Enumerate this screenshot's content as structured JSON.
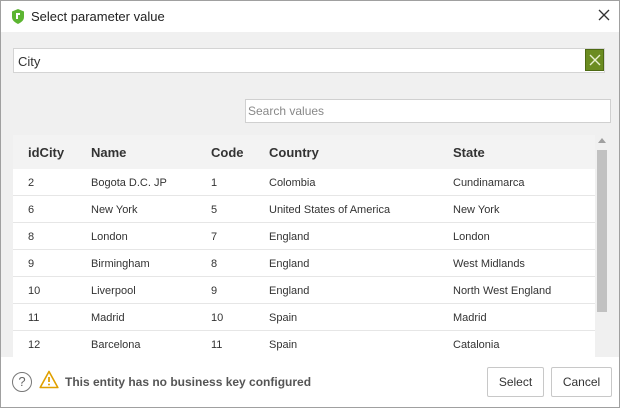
{
  "window": {
    "title": "Select parameter value",
    "icon": "app-shield-icon",
    "close_icon": "close-icon"
  },
  "parameter": {
    "value": "City",
    "clear_icon": "clear-x-icon",
    "clear_color": "#6b8c21"
  },
  "search": {
    "placeholder": "Search values",
    "value": ""
  },
  "table": {
    "columns": [
      "idCity",
      "Name",
      "Code",
      "Country",
      "State"
    ],
    "rows": [
      [
        "2",
        "Bogota D.C. JP",
        "1",
        "Colombia",
        "Cundinamarca"
      ],
      [
        "6",
        "New York",
        "5",
        "United States of America",
        "New York"
      ],
      [
        "8",
        "London",
        "7",
        "England",
        "London"
      ],
      [
        "9",
        "Birmingham",
        "8",
        "England",
        "West Midlands"
      ],
      [
        "10",
        "Liverpool",
        "9",
        "England",
        "North West England"
      ],
      [
        "11",
        "Madrid",
        "10",
        "Spain",
        "Madrid"
      ],
      [
        "12",
        "Barcelona",
        "11",
        "Spain",
        "Catalonia"
      ]
    ]
  },
  "footer": {
    "help_icon": "help-question-icon",
    "help_glyph": "?",
    "warning_icon": "warning-triangle-icon",
    "warning_text": "This entity has no business key configured",
    "select_label": "Select",
    "cancel_label": "Cancel"
  }
}
